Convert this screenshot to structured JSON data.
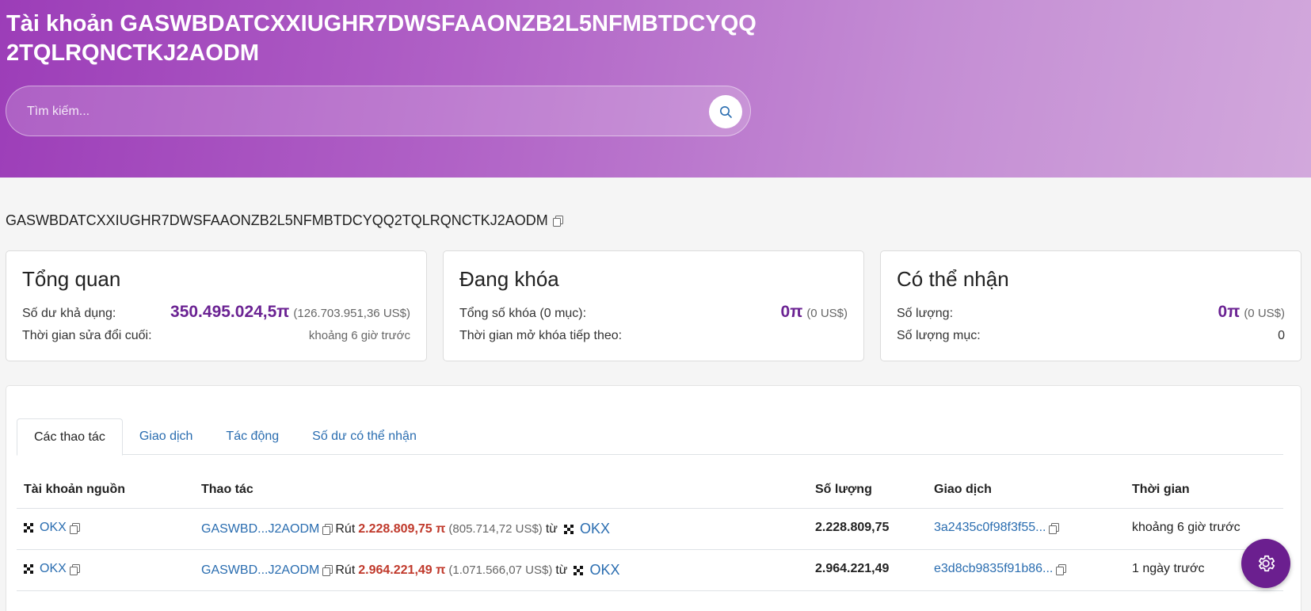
{
  "header": {
    "title": "Tài khoản GASWBDATCXXIUGHR7DWSFAAONZB2L5NFMBTDCYQQ2TQLRQNCTKJ2AODM",
    "search_placeholder": "Tìm kiếm..."
  },
  "account_id": "GASWBDATCXXIUGHR7DWSFAAONZB2L5NFMBTDCYQQ2TQLRQNCTKJ2AODM",
  "overview": {
    "title": "Tổng quan",
    "balance_label": "Số dư khả dụng:",
    "balance_value": "350.495.024,5π",
    "balance_usd": "(126.703.951,36 US$)",
    "modified_label": "Thời gian sửa đổi cuối:",
    "modified_value": "khoảng 6 giờ trước"
  },
  "locked": {
    "title": "Đang khóa",
    "total_label": "Tổng số khóa (0 mục):",
    "total_value": "0π",
    "total_usd": "(0 US$)",
    "next_unlock_label": "Thời gian mở khóa tiếp theo:"
  },
  "claimable": {
    "title": "Có thể nhận",
    "amount_label": "Số lượng:",
    "amount_value": "0π",
    "amount_usd": "(0 US$)",
    "count_label": "Số lượng mục:",
    "count_value": "0"
  },
  "tabs": [
    {
      "label": "Các thao tác",
      "active": true
    },
    {
      "label": "Giao dịch",
      "active": false
    },
    {
      "label": "Tác động",
      "active": false
    },
    {
      "label": "Số dư có thể nhận",
      "active": false
    }
  ],
  "table": {
    "headers": [
      "Tài khoản nguồn",
      "Thao tác",
      "Số lượng",
      "Giao dịch",
      "Thời gian"
    ],
    "rows": [
      {
        "source": "OKX",
        "op_account": "GASWBD...J2AODM",
        "op_verb": "Rút",
        "op_amount": "2.228.809,75 π",
        "op_usd": "(805.714,72 US$)",
        "op_from": "từ",
        "op_dest": "OKX",
        "amount": "2.228.809,75",
        "tx": "3a2435c0f98f3f55...",
        "time": "khoảng 6 giờ trước"
      },
      {
        "source": "OKX",
        "op_account": "GASWBD...J2AODM",
        "op_verb": "Rút",
        "op_amount": "2.964.221,49 π",
        "op_usd": "(1.071.566,07 US$)",
        "op_from": "từ",
        "op_dest": "OKX",
        "amount": "2.964.221,49",
        "tx": "e3d8cb9835f91b86...",
        "time": "1 ngày trước"
      }
    ]
  },
  "colors": {
    "brand_purple": "#6b2393",
    "link_blue": "#2a6db0",
    "amount_red": "#c0392b"
  },
  "icons": [
    "search-icon",
    "copy-icon",
    "okx-logo-icon",
    "gear-icon"
  ]
}
